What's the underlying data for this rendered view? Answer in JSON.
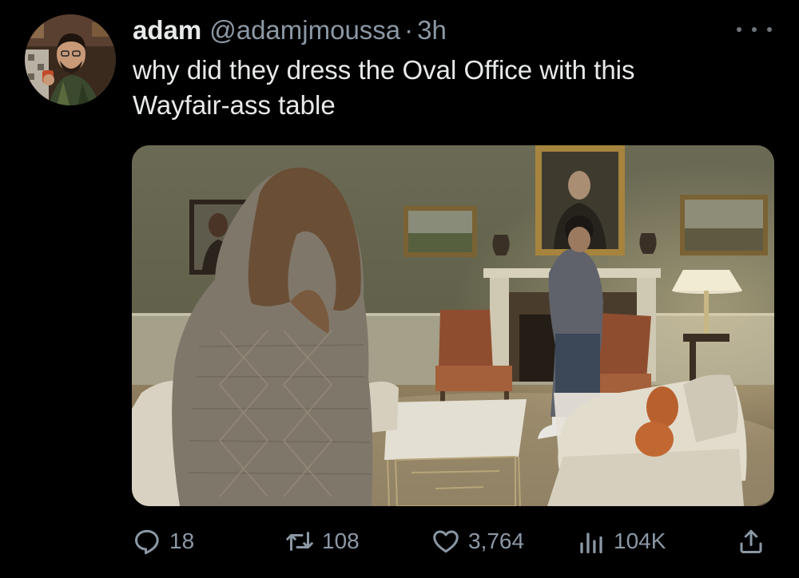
{
  "tweet": {
    "display_name": "adam",
    "handle": "@adamjmoussa",
    "separator": "·",
    "time": "3h",
    "text": "why did they dress the Oval Office with this\nWayfair-ass table"
  },
  "actions": {
    "replies": "18",
    "retweets": "108",
    "likes": "3,764",
    "views": "104K"
  },
  "icons": {
    "reply": "reply-icon",
    "retweet": "retweet-icon",
    "like": "heart-icon",
    "views": "views-icon",
    "share": "share-icon",
    "more": "more-icon"
  },
  "colors": {
    "background": "#000000",
    "text": "#e7e9ea",
    "secondary": "#8b98a5"
  }
}
